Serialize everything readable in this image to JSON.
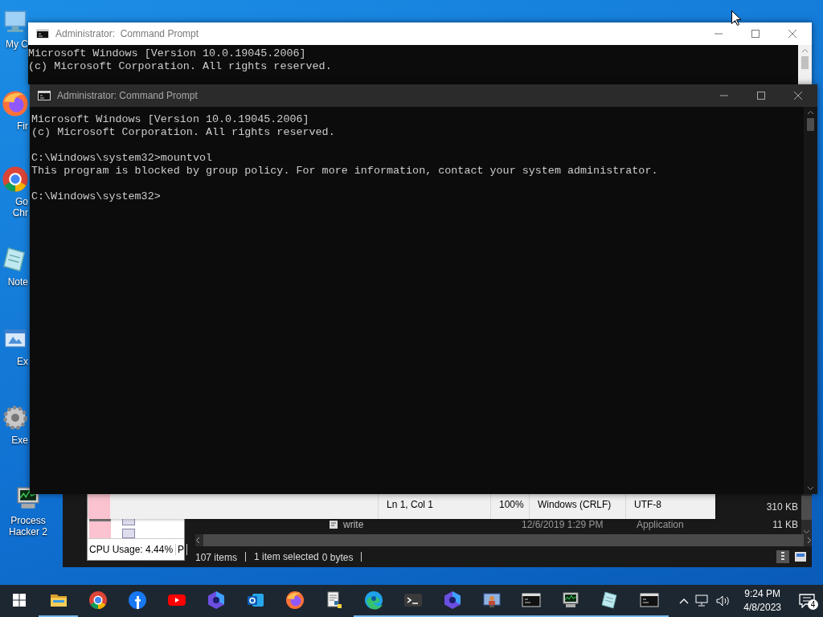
{
  "desktop_icons": [
    {
      "kind": "computer",
      "lines": [
        "My C"
      ]
    },
    {
      "kind": "flame",
      "lines": [
        "Fir"
      ]
    },
    {
      "kind": "ring",
      "lines": [
        "Go",
        "Chr"
      ]
    },
    {
      "kind": "notepad",
      "lines": [
        "Note"
      ]
    },
    {
      "kind": "window",
      "lines": [
        "Ex"
      ]
    },
    {
      "kind": "gear",
      "lines": [
        "Exe"
      ]
    },
    {
      "kind": "monitor",
      "lines": [
        "Process",
        "Hacker 2"
      ]
    }
  ],
  "back_console": {
    "title": "Administrator:  Command Prompt",
    "lines": [
      "Microsoft Windows [Version 10.0.19045.2006]",
      "(c) Microsoft Corporation. All rights reserved."
    ]
  },
  "front_console": {
    "title": "Administrator: Command Prompt",
    "blocks": [
      [
        "Microsoft Windows [Version 10.0.19045.2006]",
        "(c) Microsoft Corporation. All rights reserved."
      ],
      [
        "C:\\Windows\\system32>mountvol",
        "This program is blocked by group policy. For more information, contact your system administrator."
      ],
      [
        "C:\\Windows\\system32>"
      ]
    ]
  },
  "notepad": {
    "status": [
      "Ln 1, Col 1",
      "100%",
      "Windows (CRLF)",
      "UTF-8"
    ]
  },
  "process_hacker": {
    "status": [
      "CPU Usage: 4.44%",
      "P"
    ]
  },
  "explorer": {
    "rows": [
      {
        "size": "310 KB"
      },
      {
        "name": "write",
        "date": "12/6/2019 1:29 PM",
        "type": "Application",
        "size": "11 KB"
      }
    ],
    "status": [
      "107 items",
      "1 item selected",
      "0 bytes"
    ]
  },
  "taskbar": {
    "apps": [
      {
        "kind": "folder",
        "running": true
      },
      {
        "kind": "ring",
        "running": false
      },
      {
        "kind": "social",
        "running": false
      },
      {
        "kind": "play",
        "running": false
      },
      {
        "kind": "hexagon",
        "running": false
      },
      {
        "kind": "mail",
        "running": false
      },
      {
        "kind": "flame",
        "running": false
      },
      {
        "kind": "document",
        "running": false
      },
      {
        "kind": "swirl",
        "running": true
      },
      {
        "kind": "terminal",
        "running": true
      },
      {
        "kind": "hexagon",
        "running": true
      },
      {
        "kind": "screen",
        "running": true
      },
      {
        "kind": "console",
        "running": true
      },
      {
        "kind": "monitor",
        "running": true
      },
      {
        "kind": "notepad",
        "running": true
      },
      {
        "kind": "console",
        "running": true
      }
    ],
    "time": "9:24 PM",
    "date": "4/8/2023",
    "notifications": "4"
  }
}
